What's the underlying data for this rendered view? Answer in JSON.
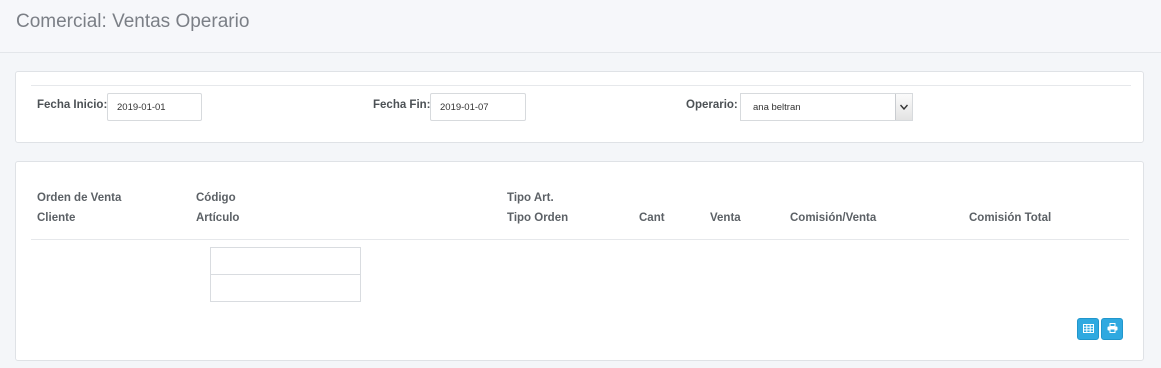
{
  "header": {
    "title": "Comercial: Ventas Operario"
  },
  "filters": {
    "start_date": {
      "label": "Fecha Inicio:",
      "value": "2019-01-01"
    },
    "end_date": {
      "label": "Fecha Fin:",
      "value": "2019-01-07"
    },
    "operator": {
      "label": "Operario:",
      "selected": "ana beltran"
    }
  },
  "table": {
    "columns": [
      {
        "line1": "Orden de Venta",
        "line2": "Cliente"
      },
      {
        "line1": "Código",
        "line2": "Artículo"
      },
      {
        "line1": "Tipo Art.",
        "line2": "Tipo Orden"
      },
      {
        "line1": "",
        "line2": "Cant"
      },
      {
        "line1": "",
        "line2": "Venta"
      },
      {
        "line1": "",
        "line2": "Comisión/Venta"
      },
      {
        "line1": "",
        "line2": "Comisión Total"
      }
    ]
  },
  "actions": {
    "excel_icon": "table-icon",
    "print_icon": "print-icon",
    "button_color": "#2fa9e0"
  }
}
